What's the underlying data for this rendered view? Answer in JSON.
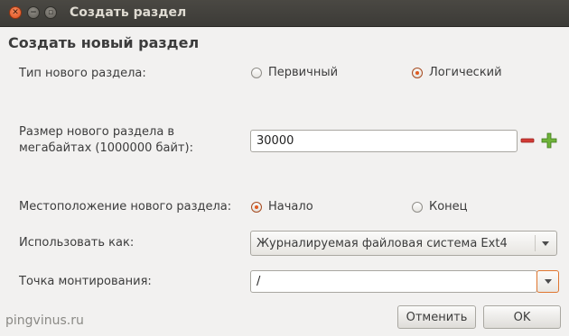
{
  "window": {
    "title": "Создать раздел",
    "buttons": {
      "close": "✕",
      "minimize": "−",
      "maximize": "▫"
    }
  },
  "heading": "Создать новый раздел",
  "partition_type": {
    "label": "Тип нового раздела:",
    "options": [
      {
        "label": "Первичный",
        "selected": false
      },
      {
        "label": "Логический",
        "selected": true
      }
    ]
  },
  "size": {
    "label_line1": "Размер нового раздела в",
    "label_line2": "мегабайтах (1000000 байт):",
    "value": "30000",
    "decrement_icon": "minus-icon",
    "increment_icon": "plus-icon"
  },
  "location": {
    "label": "Местоположение нового раздела:",
    "options": [
      {
        "label": "Начало",
        "selected": true
      },
      {
        "label": "Конец",
        "selected": false
      }
    ]
  },
  "use_as": {
    "label": "Использовать как:",
    "selected": "Журналируемая файловая система Ext4"
  },
  "mount_point": {
    "label": "Точка монтирования:",
    "value": "/"
  },
  "actions": {
    "cancel": "Отменить",
    "ok": "OK"
  },
  "watermark": "pingvinus.ru",
  "colors": {
    "titlebar": "#3c3b37",
    "accent": "#e05a1f",
    "background": "#f2f1f0",
    "plus": "#5aa02c",
    "minus": "#d23b35"
  }
}
